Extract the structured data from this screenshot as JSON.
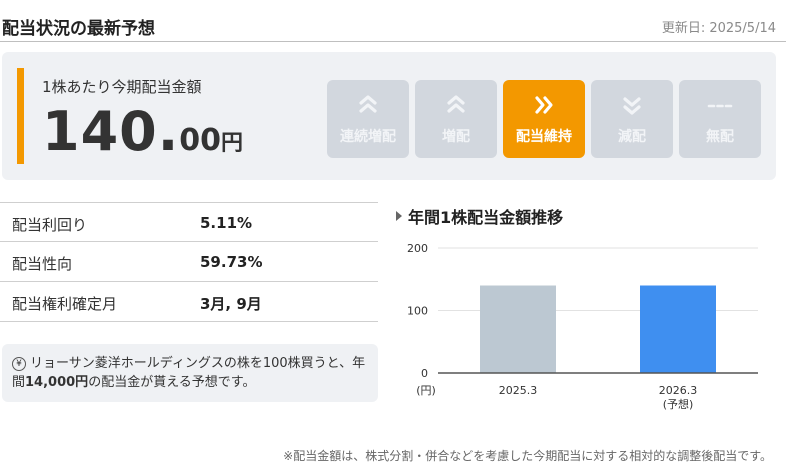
{
  "header": {
    "title": "配当状況の最新予想",
    "updated": "更新日: 2025/5/14"
  },
  "summary": {
    "label": "1株あたり今期配当金額",
    "amount_int": "140.",
    "amount_dec": "00",
    "amount_unit": "円",
    "accent_color": "#f39800",
    "buttons": [
      {
        "label": "連続増配",
        "icon": "double-chevron-up-icon",
        "active": false
      },
      {
        "label": "増配",
        "icon": "chevron-up-icon",
        "active": false
      },
      {
        "label": "配当維持",
        "icon": "double-chevron-right-icon",
        "active": true
      },
      {
        "label": "減配",
        "icon": "double-chevron-down-icon",
        "active": false
      },
      {
        "label": "無配",
        "icon": "dash-icon",
        "active": false
      }
    ]
  },
  "table": [
    {
      "key": "配当利回り",
      "value": "5.11%"
    },
    {
      "key": "配当性向",
      "value": "59.73%"
    },
    {
      "key": "配当権利確定月",
      "value": "3月, 9月"
    }
  ],
  "note": {
    "part1": "リョーサン菱洋ホールディングスの株を100株買うと、年間",
    "bold": "14,000円",
    "part2": "の配当金が貰える予想です。"
  },
  "chart_title": "年間1株配当金額推移",
  "chart_data": {
    "type": "bar",
    "categories": [
      "2025.3",
      "2026.3"
    ],
    "category_sublabels": [
      "",
      "(予想)"
    ],
    "values": [
      140,
      140
    ],
    "colors": [
      "#bcc8d2",
      "#3f8ff0"
    ],
    "ylim": [
      0,
      200
    ],
    "yticks": [
      0,
      100,
      200
    ],
    "yunit": "(円)",
    "grid": true
  },
  "footnote": "※配当金額は、株式分割・併合などを考慮した今期配当に対する相対的な調整後配当です。"
}
